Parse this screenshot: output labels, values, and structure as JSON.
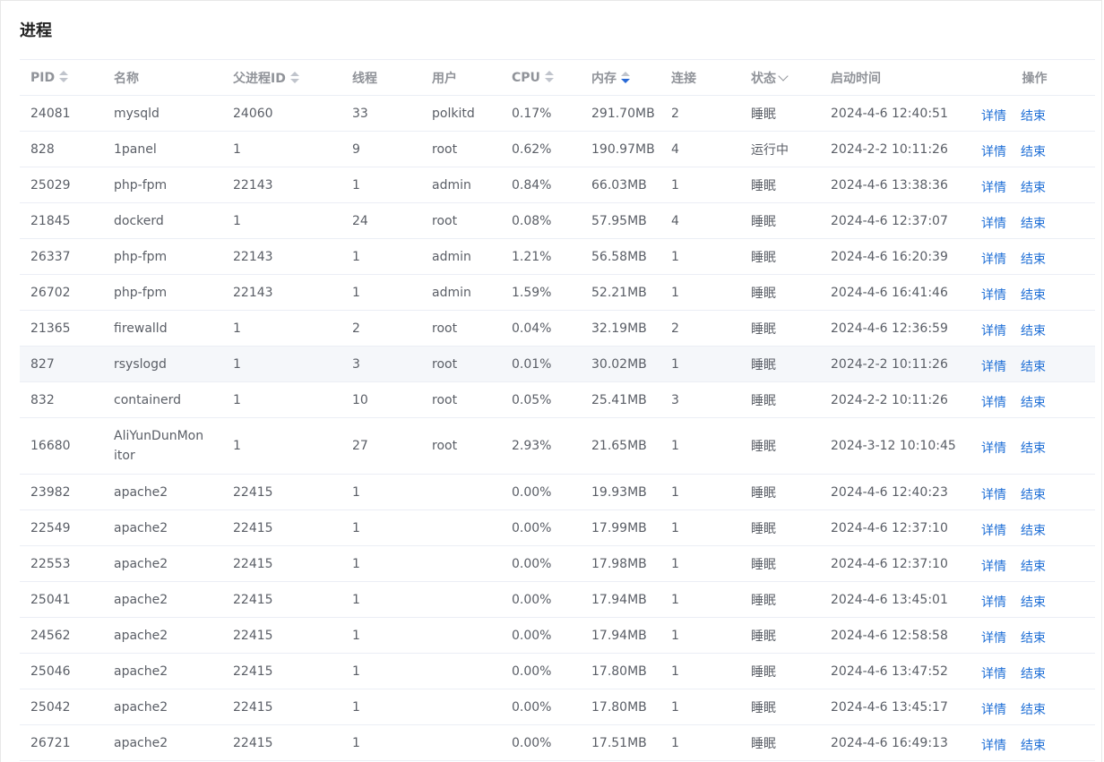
{
  "title": "进程",
  "headers": {
    "pid": "PID",
    "name": "名称",
    "ppid": "父进程ID",
    "threads": "线程",
    "user": "用户",
    "cpu": "CPU",
    "mem": "内存",
    "conn": "连接",
    "status": "状态",
    "start": "启动时间",
    "ops": "操作"
  },
  "actions": {
    "detail": "详情",
    "kill": "结束"
  },
  "rows": [
    {
      "pid": "24081",
      "name": "mysqld",
      "ppid": "24060",
      "threads": "33",
      "user": "polkitd",
      "cpu": "0.17%",
      "mem": "291.70MB",
      "conn": "2",
      "status": "睡眠",
      "start": "2024-4-6 12:40:51"
    },
    {
      "pid": "828",
      "name": "1panel",
      "ppid": "1",
      "threads": "9",
      "user": "root",
      "cpu": "0.62%",
      "mem": "190.97MB",
      "conn": "4",
      "status": "运行中",
      "start": "2024-2-2 10:11:26"
    },
    {
      "pid": "25029",
      "name": "php-fpm",
      "ppid": "22143",
      "threads": "1",
      "user": "admin",
      "cpu": "0.84%",
      "mem": "66.03MB",
      "conn": "1",
      "status": "睡眠",
      "start": "2024-4-6 13:38:36"
    },
    {
      "pid": "21845",
      "name": "dockerd",
      "ppid": "1",
      "threads": "24",
      "user": "root",
      "cpu": "0.08%",
      "mem": "57.95MB",
      "conn": "4",
      "status": "睡眠",
      "start": "2024-4-6 12:37:07"
    },
    {
      "pid": "26337",
      "name": "php-fpm",
      "ppid": "22143",
      "threads": "1",
      "user": "admin",
      "cpu": "1.21%",
      "mem": "56.58MB",
      "conn": "1",
      "status": "睡眠",
      "start": "2024-4-6 16:20:39"
    },
    {
      "pid": "26702",
      "name": "php-fpm",
      "ppid": "22143",
      "threads": "1",
      "user": "admin",
      "cpu": "1.59%",
      "mem": "52.21MB",
      "conn": "1",
      "status": "睡眠",
      "start": "2024-4-6 16:41:46"
    },
    {
      "pid": "21365",
      "name": "firewalld",
      "ppid": "1",
      "threads": "2",
      "user": "root",
      "cpu": "0.04%",
      "mem": "32.19MB",
      "conn": "2",
      "status": "睡眠",
      "start": "2024-4-6 12:36:59"
    },
    {
      "pid": "827",
      "name": "rsyslogd",
      "ppid": "1",
      "threads": "3",
      "user": "root",
      "cpu": "0.01%",
      "mem": "30.02MB",
      "conn": "1",
      "status": "睡眠",
      "start": "2024-2-2 10:11:26"
    },
    {
      "pid": "832",
      "name": "containerd",
      "ppid": "1",
      "threads": "10",
      "user": "root",
      "cpu": "0.05%",
      "mem": "25.41MB",
      "conn": "3",
      "status": "睡眠",
      "start": "2024-2-2 10:11:26"
    },
    {
      "pid": "16680",
      "name": "AliYunDunMonitor",
      "ppid": "1",
      "threads": "27",
      "user": "root",
      "cpu": "2.93%",
      "mem": "21.65MB",
      "conn": "1",
      "status": "睡眠",
      "start": "2024-3-12 10:10:45"
    },
    {
      "pid": "23982",
      "name": "apache2",
      "ppid": "22415",
      "threads": "1",
      "user": "",
      "cpu": "0.00%",
      "mem": "19.93MB",
      "conn": "1",
      "status": "睡眠",
      "start": "2024-4-6 12:40:23"
    },
    {
      "pid": "22549",
      "name": "apache2",
      "ppid": "22415",
      "threads": "1",
      "user": "",
      "cpu": "0.00%",
      "mem": "17.99MB",
      "conn": "1",
      "status": "睡眠",
      "start": "2024-4-6 12:37:10"
    },
    {
      "pid": "22553",
      "name": "apache2",
      "ppid": "22415",
      "threads": "1",
      "user": "",
      "cpu": "0.00%",
      "mem": "17.98MB",
      "conn": "1",
      "status": "睡眠",
      "start": "2024-4-6 12:37:10"
    },
    {
      "pid": "25041",
      "name": "apache2",
      "ppid": "22415",
      "threads": "1",
      "user": "",
      "cpu": "0.00%",
      "mem": "17.94MB",
      "conn": "1",
      "status": "睡眠",
      "start": "2024-4-6 13:45:01"
    },
    {
      "pid": "24562",
      "name": "apache2",
      "ppid": "22415",
      "threads": "1",
      "user": "",
      "cpu": "0.00%",
      "mem": "17.94MB",
      "conn": "1",
      "status": "睡眠",
      "start": "2024-4-6 12:58:58"
    },
    {
      "pid": "25046",
      "name": "apache2",
      "ppid": "22415",
      "threads": "1",
      "user": "",
      "cpu": "0.00%",
      "mem": "17.80MB",
      "conn": "1",
      "status": "睡眠",
      "start": "2024-4-6 13:47:52"
    },
    {
      "pid": "25042",
      "name": "apache2",
      "ppid": "22415",
      "threads": "1",
      "user": "",
      "cpu": "0.00%",
      "mem": "17.80MB",
      "conn": "1",
      "status": "睡眠",
      "start": "2024-4-6 13:45:17"
    },
    {
      "pid": "26721",
      "name": "apache2",
      "ppid": "22415",
      "threads": "1",
      "user": "",
      "cpu": "0.00%",
      "mem": "17.51MB",
      "conn": "1",
      "status": "睡眠",
      "start": "2024-4-6 16:49:13"
    }
  ]
}
